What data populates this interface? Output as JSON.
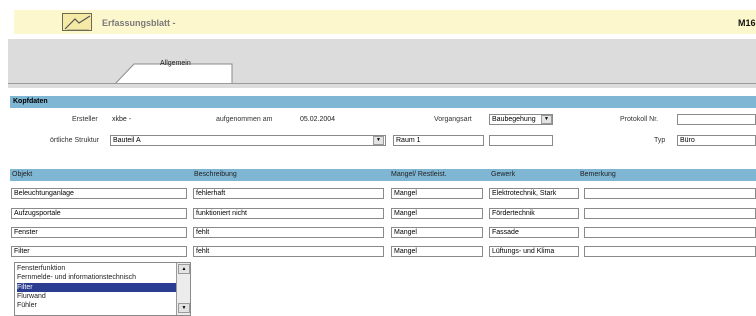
{
  "header": {
    "title": "Erfassungsblatt -",
    "doc_id": "M16"
  },
  "tabs": [
    {
      "label": "Allgemein"
    }
  ],
  "kopfdaten": {
    "section_title": "Kopfdaten",
    "ersteller_label": "Ersteller",
    "ersteller_value": "xkbe -",
    "aufgenommen_label": "aufgenommen am",
    "aufgenommen_value": "05.02.2004",
    "vorgangsart_label": "Vorgangsart",
    "vorgangsart_value": "Baubegehung",
    "protokoll_label": "Protokoll Nr.",
    "protokoll_value": "",
    "struktur_label": "örtliche Struktur",
    "struktur_value": "Bauteil A",
    "raum_value": "Raum 1",
    "extra_value": "",
    "typ_label": "Typ",
    "typ_value": "Büro"
  },
  "grid": {
    "headers": [
      "Objekt",
      "Beschreibung",
      "Mangel/ Restleist.",
      "Gewerk",
      "Bemerkung"
    ],
    "rows": [
      {
        "objekt": "Beleuchtunganlage",
        "beschreibung": "fehlerhaft",
        "mangel": "Mangel",
        "gewerk": "Elektrotechnik, Stark",
        "bemerkung": ""
      },
      {
        "objekt": "Aufzugsportale",
        "beschreibung": "funktioniert nicht",
        "mangel": "Mangel",
        "gewerk": "Fördertechnik",
        "bemerkung": ""
      },
      {
        "objekt": "Fenster",
        "beschreibung": "fehlt",
        "mangel": "Mangel",
        "gewerk": "Fassade",
        "bemerkung": ""
      },
      {
        "objekt": "Filter",
        "beschreibung": "fehlt",
        "mangel": "Mangel",
        "gewerk": "Lüftungs- und Klima",
        "bemerkung": ""
      }
    ]
  },
  "dropdown": {
    "items": [
      "Fensterfunktion",
      "Fernmelde- und informationstechnisch",
      "Filter",
      "Flurwand",
      "Fühler"
    ],
    "selected_index": 2
  },
  "colors": {
    "header_band": "#fdf7cd",
    "section_bar": "#7fb6d3",
    "selection": "#2b3d90"
  }
}
